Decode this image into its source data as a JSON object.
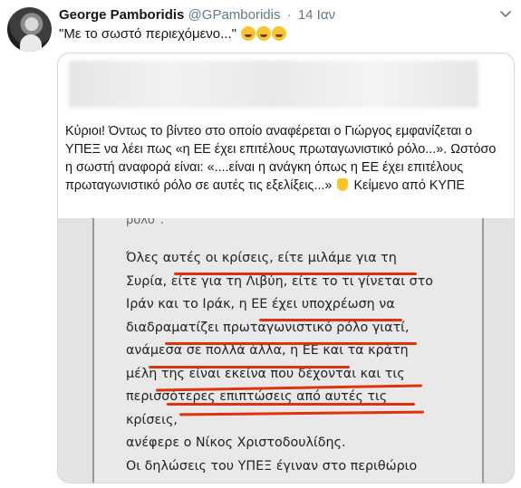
{
  "tweet": {
    "author_name": "George Pamboridis",
    "handle": "@GPamboridis",
    "separator": "·",
    "time": "14 Ιαν",
    "text": "\"Με το σωστό περιεχόμενο...\"",
    "emoji_count": 3
  },
  "quoted": {
    "text_part1": "Κύριοι! Όντως το βίντεο στο οποίο αναφέρεται ο Γιώργος εμφανίζεται ο ΥΠΕΞ να λέει πως «η ΕΕ έχει επιτέλους πρωταγωνιστικό ρόλο...». Ωστόσο η σωστή αναφορά είναι: «....είναι η ανάγκη όπως η ΕΕ έχει επιτέλους πρωταγωνιστικό ρόλο σε αυτές τις εξελίξεις...»",
    "text_part2": "Κείμενο από ΚΥΠΕ",
    "image_doc": {
      "top_cut": "ρόλο\".",
      "lines": [
        "Όλες αυτές οι κρίσεις, είτε μιλάμε για τη",
        "Συρία, είτε για τη Λιβύη, είτε το τι γίνεται στο",
        "Ιράν και το Ιράκ, η ΕΕ έχει υποχρέωση να",
        "διαδραματίζει πρωταγωνιστικό ρόλο γιατί,",
        "ανάμεσα σε πολλά άλλα, η ΕΕ και τα κράτη",
        "μέλη της είναι εκείνα που δέχονται και τις",
        "περισσότερες επιπτώσεις από αυτές τις κρίσεις,",
        "ανέφερε ο Νίκος Χριστοδουλίδης."
      ],
      "bottom_line": "Οι δηλώσεις του ΥΠΕΞ έγιναν στο περιθώριο"
    }
  },
  "colors": {
    "text": "#14171a",
    "secondary": "#657786",
    "border": "#ccd6dd",
    "underline": "#e0320b"
  }
}
